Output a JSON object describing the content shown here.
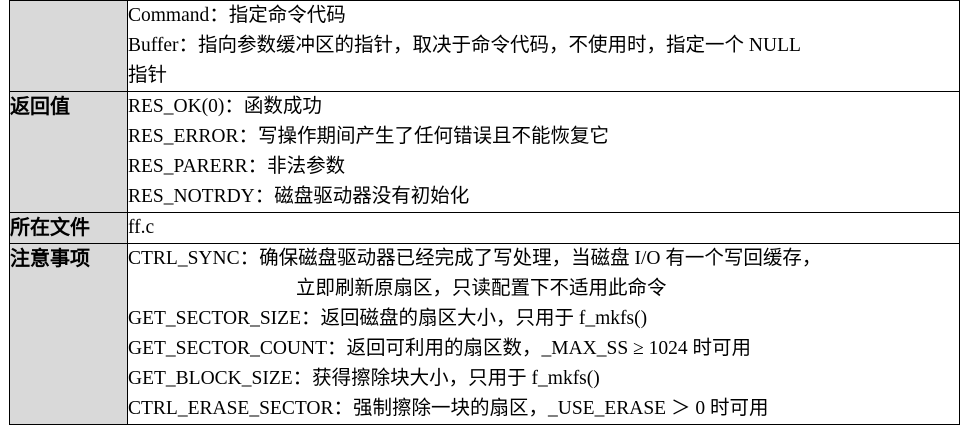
{
  "rows": [
    {
      "key": "",
      "lines": [
        "Command：指定命令代码",
        "Buffer：指向参数缓冲区的指针，取决于命令代码，不使用时，指定一个 NULL",
        "指针"
      ]
    },
    {
      "key": "返回值",
      "lines": [
        "RES_OK(0)：函数成功",
        "RES_ERROR：写操作期间产生了任何错误且不能恢复它",
        "RES_PARERR：非法参数",
        "RES_NOTRDY：磁盘驱动器没有初始化"
      ]
    },
    {
      "key": "所在文件",
      "lines": [
        "ff.c"
      ]
    },
    {
      "key": "注意事项",
      "lines": [
        "CTRL_SYNC：确保磁盘驱动器已经完成了写处理，当磁盘 I/O 有一个写回缓存，",
        "立即刷新原扇区，只读配置下不适用此命令",
        "GET_SECTOR_SIZE：返回磁盘的扇区大小，只用于 f_mkfs()",
        "GET_SECTOR_COUNT：返回可利用的扇区数，_MAX_SS ≥ 1024 时可用",
        "GET_BLOCK_SIZE：获得擦除块大小，只用于 f_mkfs()",
        "CTRL_ERASE_SECTOR：强制擦除一块的扇区，_USE_ERASE ＞ 0 时可用"
      ]
    }
  ]
}
